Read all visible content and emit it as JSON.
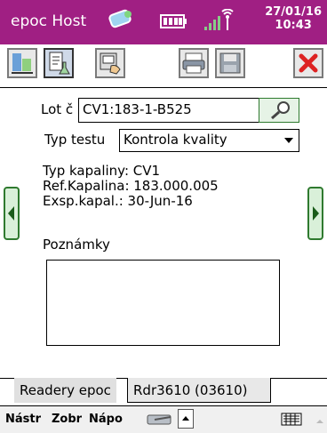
{
  "titlebar": {
    "app_title": "epoc Host",
    "date": "27/01/16",
    "time": "10:43"
  },
  "form": {
    "lot_label": "Lot č",
    "lot_value": "CV1:183-1-B525",
    "test_type_label": "Typ testu",
    "test_type_value": "Kontrola kvality",
    "fluid_type": "Typ kapaliny: CV1",
    "ref_fluid": "Ref.Kapalina: 183.000.005",
    "exp_fluid": "Exsp.kapal.: 30-Jun-16",
    "notes_label": "Poznámky",
    "notes_value": ""
  },
  "tabs": [
    {
      "label": "Readery epoc"
    },
    {
      "label": "Rdr3610 (03610)"
    }
  ],
  "menu": [
    {
      "label": "Nástr"
    },
    {
      "label": "Zobr"
    },
    {
      "label": "Nápo"
    }
  ],
  "colors": {
    "titlebar": "#a01f83",
    "nav_green": "#2f7a2f",
    "close_red": "#d22"
  }
}
